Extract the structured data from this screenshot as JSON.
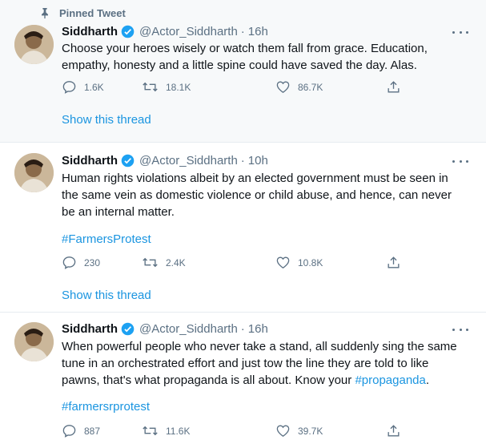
{
  "pinned_label": "Pinned Tweet",
  "tweets": [
    {
      "name": "Siddharth",
      "handle": "@Actor_Siddharth",
      "dot": "·",
      "time": "16h",
      "text": "Choose your heroes wisely or watch them fall from grace. Education, empathy, honesty and a little spine could have saved the day. Alas.",
      "hashtag": "",
      "replies": "1.6K",
      "retweets": "18.1K",
      "likes": "86.7K",
      "show_thread": "Show this thread"
    },
    {
      "name": "Siddharth",
      "handle": "@Actor_Siddharth",
      "dot": "·",
      "time": "10h",
      "text": "Human rights violations albeit by an elected government must be seen in the same vein as domestic violence or child abuse, and hence, can never be an internal matter.",
      "hashtag": "#FarmersProtest",
      "replies": "230",
      "retweets": "2.4K",
      "likes": "10.8K",
      "show_thread": "Show this thread"
    },
    {
      "name": "Siddharth",
      "handle": "@Actor_Siddharth",
      "dot": "·",
      "time": "16h",
      "text_before": "When powerful people who never take a stand, all suddenly sing the same tune in an orchestrated effort and just tow the line they are told to like pawns, that's what propaganda is all about. Know your ",
      "inline_hashtag": "#propaganda",
      "text_after": ".",
      "hashtag": "#farmersrprotest",
      "replies": "887",
      "retweets": "11.6K",
      "likes": "39.7K"
    }
  ],
  "colors": {
    "link": "#1b95e0",
    "secondary": "#5b7083",
    "pinned_bg": "#f7f9fa",
    "divider": "#e6ecf0"
  },
  "icons": [
    "pin-icon",
    "verified-icon",
    "more-icon",
    "reply-icon",
    "retweet-icon",
    "like-icon",
    "share-icon"
  ]
}
